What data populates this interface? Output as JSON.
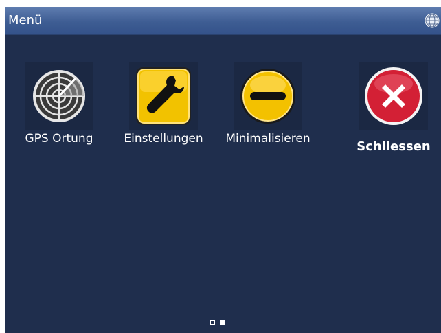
{
  "header": {
    "title": "Menü",
    "globe_icon": "globe-icon"
  },
  "menu": {
    "items": [
      {
        "label": "GPS Ortung",
        "icon": "radar-icon"
      },
      {
        "label": "Einstellungen",
        "icon": "wrench-icon"
      },
      {
        "label": "Minimalisieren",
        "icon": "minus-icon"
      },
      {
        "label": "Schliessen",
        "icon": "close-icon"
      }
    ]
  },
  "pager": {
    "pages": 2,
    "current": 2
  },
  "colors": {
    "background": "#1f2e4d",
    "titlebar": "#4a6aa1",
    "accent_yellow": "#f5c400",
    "close_red": "#d32035"
  }
}
